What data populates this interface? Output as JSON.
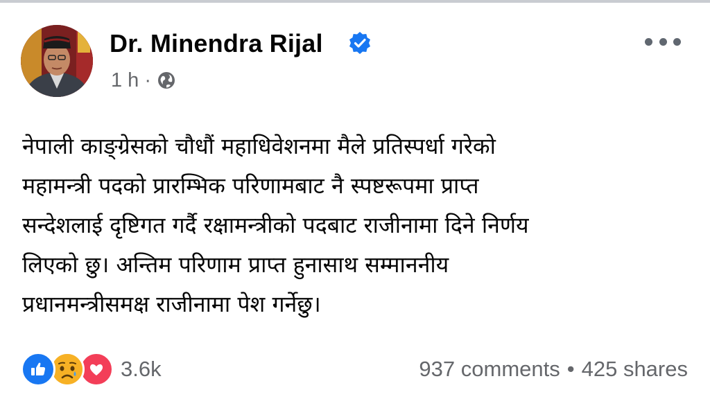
{
  "post": {
    "author": "Dr. Minendra Rijal",
    "time": "1 h",
    "separator": "·",
    "lines": [
      "नेपाली काङ्ग्रेसको चौधौं महाधिवेशनमा मैले प्रतिस्पर्धा गरेको",
      "महामन्त्री पदको प्रारम्भिक परिणामबाट नै स्पष्टरूपमा प्राप्त",
      "सन्देशलाई दृष्टिगत गर्दै रक्षामन्त्रीको पदबाट राजीनामा दिने निर्णय",
      "लिएको छु। अन्तिम परिणाम प्राप्त हुनासाथ सम्माननीय",
      "प्रधानमन्त्रीसमक्ष राजीनामा पेश गर्नेछु।"
    ]
  },
  "footer": {
    "reaction_count": "3.6k",
    "comments": "937 comments",
    "dot": "•",
    "shares": "425 shares"
  },
  "icons": {
    "verified": "verified-badge-icon",
    "audience": "globe-icon",
    "more": "more-options-icon",
    "reactions": [
      "like-icon",
      "sad-icon",
      "love-icon"
    ]
  },
  "colors": {
    "verified_blue": "#1877f2",
    "meta_gray": "#65676b",
    "like_blue": "#1877f2",
    "sad_yellow": "#f7b125",
    "love_red": "#f33e58"
  }
}
